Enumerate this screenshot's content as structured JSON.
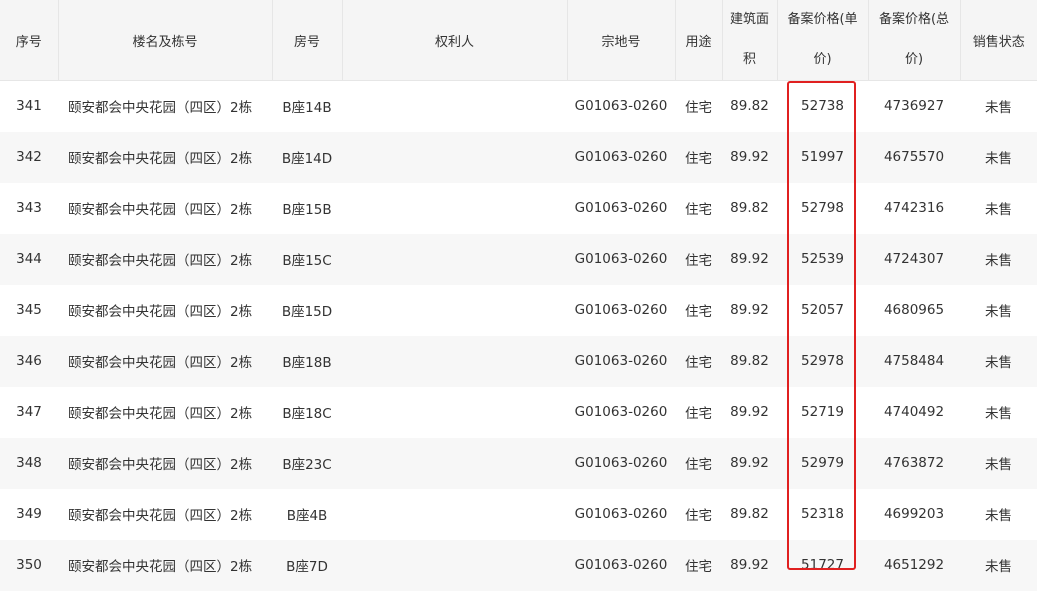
{
  "table": {
    "headers": {
      "index": "序号",
      "building": "楼名及栋号",
      "room": "房号",
      "owner": "权利人",
      "parcel": "宗地号",
      "usage": "用途",
      "area": "建筑面积",
      "unit_price": "备案价格(单价)",
      "total_price": "备案价格(总价)",
      "status": "销售状态"
    },
    "rows": [
      {
        "index": "341",
        "building": "颐安都会中央花园（四区）2栋",
        "room": "B座14B",
        "owner": "",
        "parcel": "G01063-0260",
        "usage": "住宅",
        "area": "89.82",
        "unit_price": "52738",
        "total_price": "4736927",
        "status": "未售"
      },
      {
        "index": "342",
        "building": "颐安都会中央花园（四区）2栋",
        "room": "B座14D",
        "owner": "",
        "parcel": "G01063-0260",
        "usage": "住宅",
        "area": "89.92",
        "unit_price": "51997",
        "total_price": "4675570",
        "status": "未售"
      },
      {
        "index": "343",
        "building": "颐安都会中央花园（四区）2栋",
        "room": "B座15B",
        "owner": "",
        "parcel": "G01063-0260",
        "usage": "住宅",
        "area": "89.82",
        "unit_price": "52798",
        "total_price": "4742316",
        "status": "未售"
      },
      {
        "index": "344",
        "building": "颐安都会中央花园（四区）2栋",
        "room": "B座15C",
        "owner": "",
        "parcel": "G01063-0260",
        "usage": "住宅",
        "area": "89.92",
        "unit_price": "52539",
        "total_price": "4724307",
        "status": "未售"
      },
      {
        "index": "345",
        "building": "颐安都会中央花园（四区）2栋",
        "room": "B座15D",
        "owner": "",
        "parcel": "G01063-0260",
        "usage": "住宅",
        "area": "89.92",
        "unit_price": "52057",
        "total_price": "4680965",
        "status": "未售"
      },
      {
        "index": "346",
        "building": "颐安都会中央花园（四区）2栋",
        "room": "B座18B",
        "owner": "",
        "parcel": "G01063-0260",
        "usage": "住宅",
        "area": "89.82",
        "unit_price": "52978",
        "total_price": "4758484",
        "status": "未售"
      },
      {
        "index": "347",
        "building": "颐安都会中央花园（四区）2栋",
        "room": "B座18C",
        "owner": "",
        "parcel": "G01063-0260",
        "usage": "住宅",
        "area": "89.92",
        "unit_price": "52719",
        "total_price": "4740492",
        "status": "未售"
      },
      {
        "index": "348",
        "building": "颐安都会中央花园（四区）2栋",
        "room": "B座23C",
        "owner": "",
        "parcel": "G01063-0260",
        "usage": "住宅",
        "area": "89.92",
        "unit_price": "52979",
        "total_price": "4763872",
        "status": "未售"
      },
      {
        "index": "349",
        "building": "颐安都会中央花园（四区）2栋",
        "room": "B座4B",
        "owner": "",
        "parcel": "G01063-0260",
        "usage": "住宅",
        "area": "89.82",
        "unit_price": "52318",
        "total_price": "4699203",
        "status": "未售"
      },
      {
        "index": "350",
        "building": "颐安都会中央花园（四区）2栋",
        "room": "B座7D",
        "owner": "",
        "parcel": "G01063-0260",
        "usage": "住宅",
        "area": "89.92",
        "unit_price": "51727",
        "total_price": "4651292",
        "status": "未售"
      }
    ]
  },
  "colors": {
    "header_bg": "#f5f5f5",
    "row_alt_bg": "#f7f7f7",
    "highlight_border": "#e02020",
    "text": "#333333"
  }
}
